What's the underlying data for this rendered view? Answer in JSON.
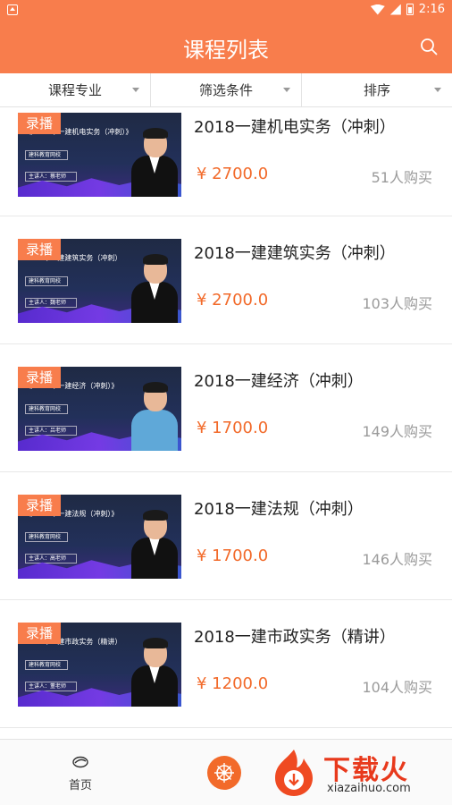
{
  "status_bar": {
    "time": "2:16"
  },
  "app_bar": {
    "title": "课程列表"
  },
  "filters": [
    {
      "label": "课程专业"
    },
    {
      "label": "筛选条件"
    },
    {
      "label": "排序"
    }
  ],
  "courses": [
    {
      "tag": "录播",
      "title": "2018一建机电实务（冲刺）",
      "price": "¥  2700.0",
      "buyers": "51人购买",
      "thumb_title": "《2018年一建机电实务（冲刺）》",
      "thumb_box1": "建科教育网校",
      "thumb_box2": "主讲人：蔡老师"
    },
    {
      "tag": "录播",
      "title": "2018一建建筑实务（冲刺）",
      "price": "¥  2700.0",
      "buyers": "103人购买",
      "thumb_title": "2018年一建建筑实务（冲刺）",
      "thumb_box1": "建科教育网校",
      "thumb_box2": "主讲人：魏老师"
    },
    {
      "tag": "录播",
      "title": "2018一建经济（冲刺）",
      "price": "¥  1700.0",
      "buyers": "149人购买",
      "thumb_title": "《2018年一建经济（冲刺）》",
      "thumb_box1": "建科教育网校",
      "thumb_box2": "主讲人：吕老师"
    },
    {
      "tag": "录播",
      "title": "2018一建法规（冲刺）",
      "price": "¥  1700.0",
      "buyers": "146人购买",
      "thumb_title": "《2018年一建法规（冲刺）》",
      "thumb_box1": "建科教育网校",
      "thumb_box2": "主讲人：高老师"
    },
    {
      "tag": "录播",
      "title": "2018一建市政实务（精讲）",
      "price": "¥  1200.0",
      "buyers": "104人购买",
      "thumb_title": "2018年一建市政实务（精讲）",
      "thumb_box1": "建科教育网校",
      "thumb_box2": "主讲人：董老师"
    }
  ],
  "tab_bar": {
    "home_label": "首页"
  },
  "watermark": {
    "cn": "下载火",
    "en": "xiazaihuo.com"
  },
  "colors": {
    "accent": "#f87d4c",
    "price": "#f26a2a"
  }
}
